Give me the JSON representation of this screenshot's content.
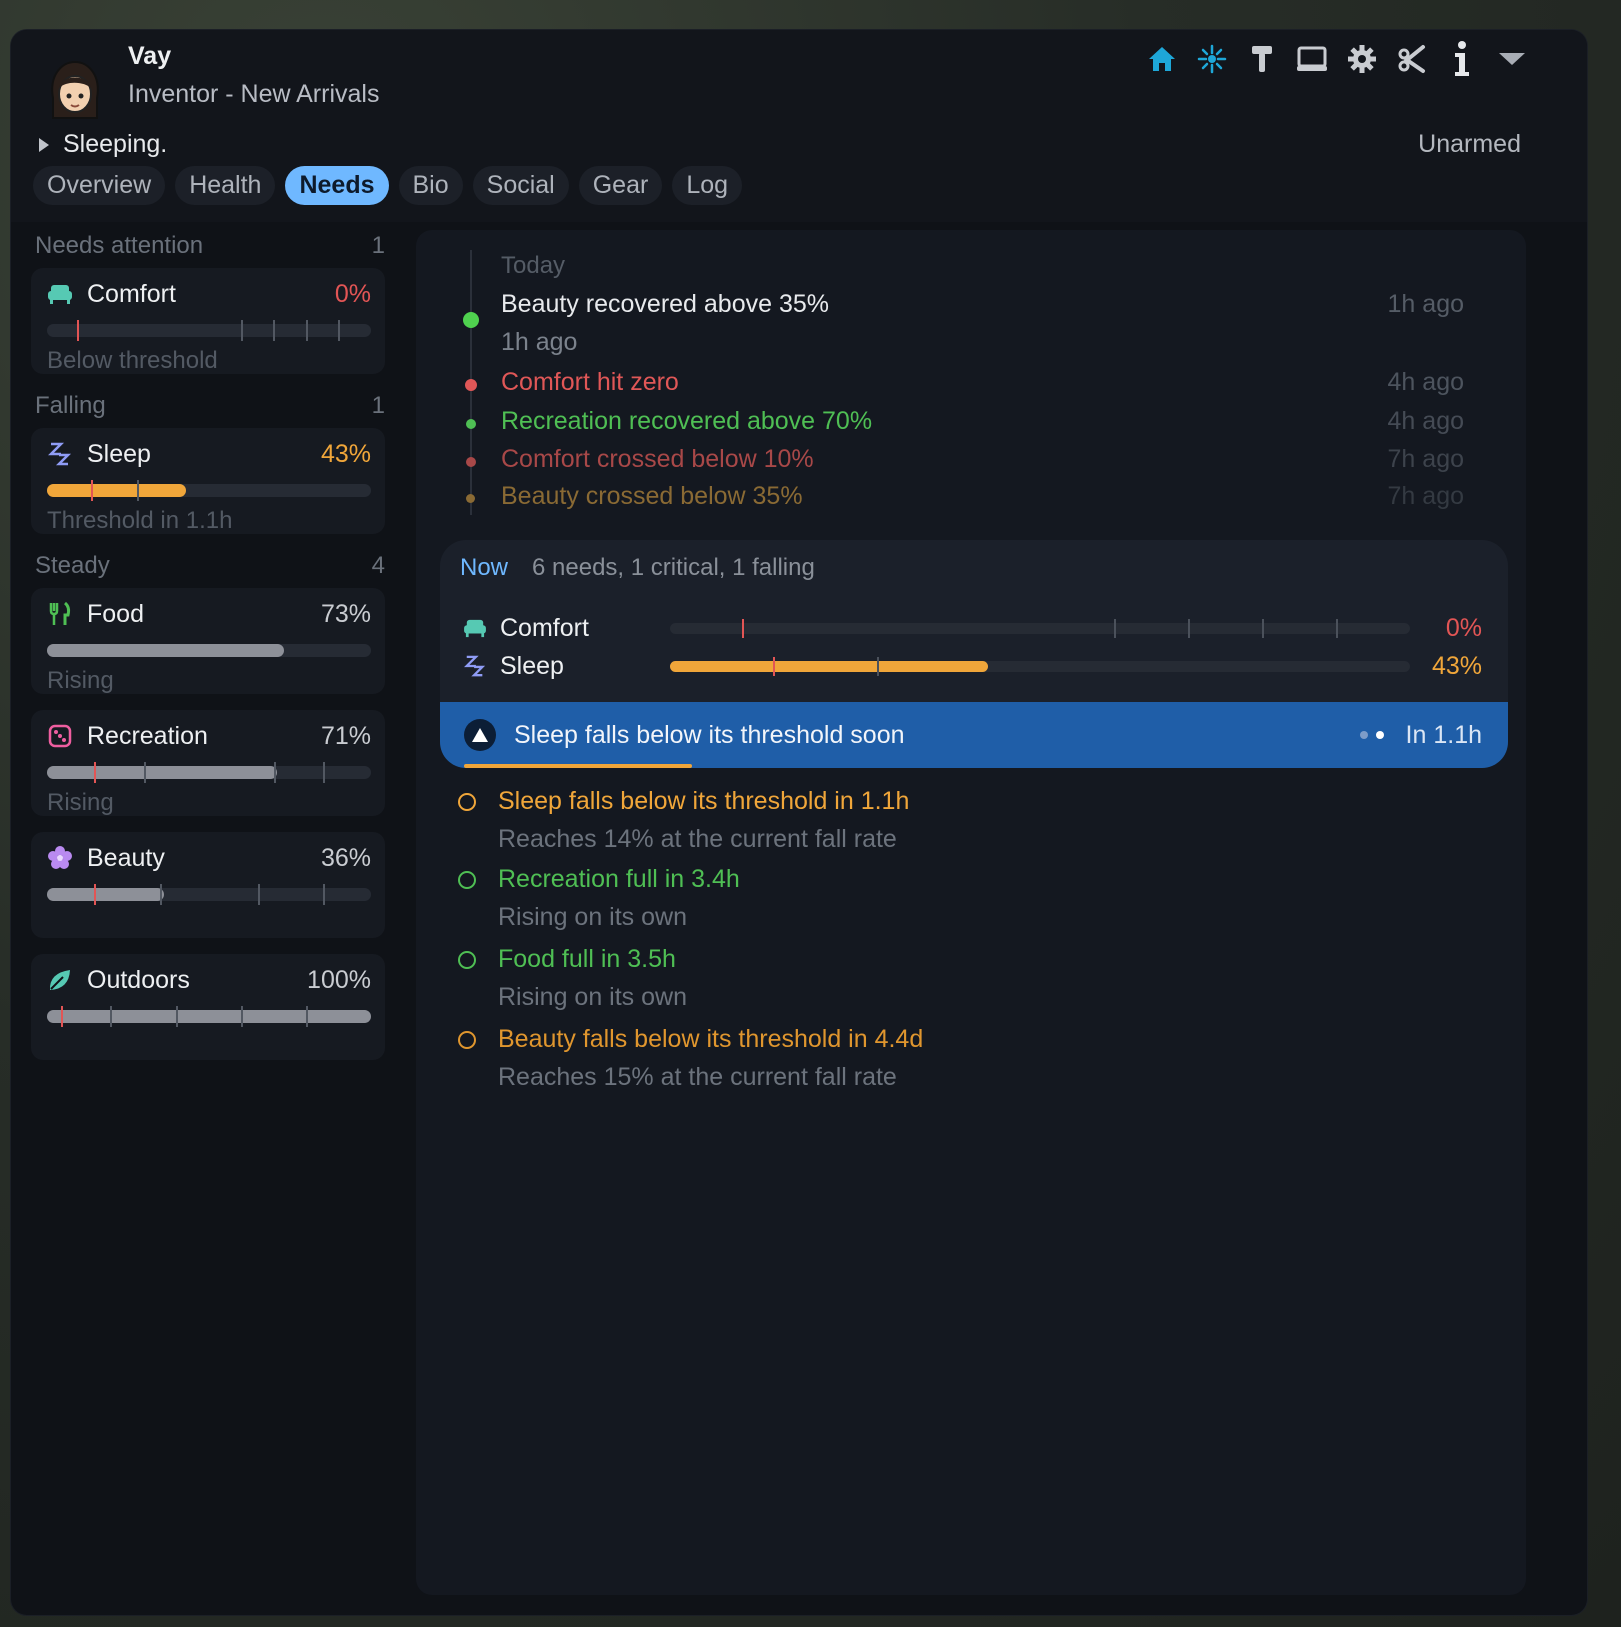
{
  "pawn": {
    "name": "Vay",
    "title": "Inventor - New Arrivals",
    "status": "Sleeping.",
    "weapon": "Unarmed"
  },
  "toolbar": {
    "icons": [
      "home-icon",
      "ideology-icon",
      "hammer-icon",
      "laptop-icon",
      "gear-icon",
      "scissors-icon",
      "info-icon",
      "collapse-icon"
    ]
  },
  "tabs": [
    {
      "label": "Overview",
      "active": false
    },
    {
      "label": "Health",
      "active": false
    },
    {
      "label": "Needs",
      "active": true
    },
    {
      "label": "Bio",
      "active": false
    },
    {
      "label": "Social",
      "active": false
    },
    {
      "label": "Gear",
      "active": false
    },
    {
      "label": "Log",
      "active": false
    }
  ],
  "sidebar": {
    "groups": [
      {
        "label": "Needs attention",
        "count": "1"
      },
      {
        "label": "Falling",
        "count": "1"
      },
      {
        "label": "Steady",
        "count": "4"
      }
    ],
    "needs": [
      {
        "name": "Comfort",
        "pct": "0%",
        "level": 0.0,
        "sub": "Below threshold",
        "icon": "sofa-icon"
      },
      {
        "name": "Sleep",
        "pct": "43%",
        "level": 0.43,
        "sub": "Threshold in 1.1h",
        "icon": "sleep-icon"
      },
      {
        "name": "Food",
        "pct": "73%",
        "level": 0.73,
        "sub": "Rising",
        "icon": "fork-knife-icon"
      },
      {
        "name": "Recreation",
        "pct": "71%",
        "level": 0.71,
        "sub": "Rising",
        "icon": "dice-icon"
      },
      {
        "name": "Beauty",
        "pct": "36%",
        "level": 0.36,
        "sub": "",
        "icon": "flower-icon"
      },
      {
        "name": "Outdoors",
        "pct": "100%",
        "level": 1.0,
        "sub": "",
        "icon": "leaf-icon"
      }
    ]
  },
  "timeline": {
    "header": "Today",
    "events": [
      {
        "text": "Beauty recovered above 35%",
        "time": "1h ago",
        "sub": "1h ago",
        "color": "#e8eaed"
      },
      {
        "text": "Comfort hit zero",
        "time": "4h ago",
        "color": "#e05757"
      },
      {
        "text": "Recreation recovered above 70%",
        "time": "4h ago",
        "color": "#4fbf54"
      },
      {
        "text": "Comfort crossed below 10%",
        "time": "7h ago",
        "color": "#a84848"
      },
      {
        "text": "Beauty crossed below 35%",
        "time": "7h ago",
        "color": "#8a6a34"
      }
    ]
  },
  "now": {
    "label": "Now",
    "summary": "6 needs, 1 critical, 1 falling",
    "rows": [
      {
        "name": "Comfort",
        "pct": "0%",
        "level": 0.0,
        "color": "#e25555"
      },
      {
        "name": "Sleep",
        "pct": "43%",
        "level": 0.43,
        "color": "#f0a63a"
      }
    ],
    "alert": {
      "text": "Sleep falls below its threshold soon",
      "eta": "In 1.1h"
    }
  },
  "forecast": [
    {
      "title": "Sleep falls below its threshold in 1.1h",
      "sub": "Reaches 14% at the current fall rate",
      "color": "#f0a63a"
    },
    {
      "title": "Recreation full in 3.4h",
      "sub": "Rising on its own",
      "color": "#4fbf54"
    },
    {
      "title": "Food full in 3.5h",
      "sub": "Rising on its own",
      "color": "#4fbf54"
    },
    {
      "title": "Beauty falls below its threshold in 4.4d",
      "sub": "Reaches 15% at the current fall rate",
      "color": "#e0962e"
    }
  ],
  "colors": {
    "accent": "#6fb8ff",
    "critical": "#e25555",
    "warning": "#f0a63a",
    "ok": "#4fbf54",
    "alert_bg": "#1f5ea8"
  }
}
